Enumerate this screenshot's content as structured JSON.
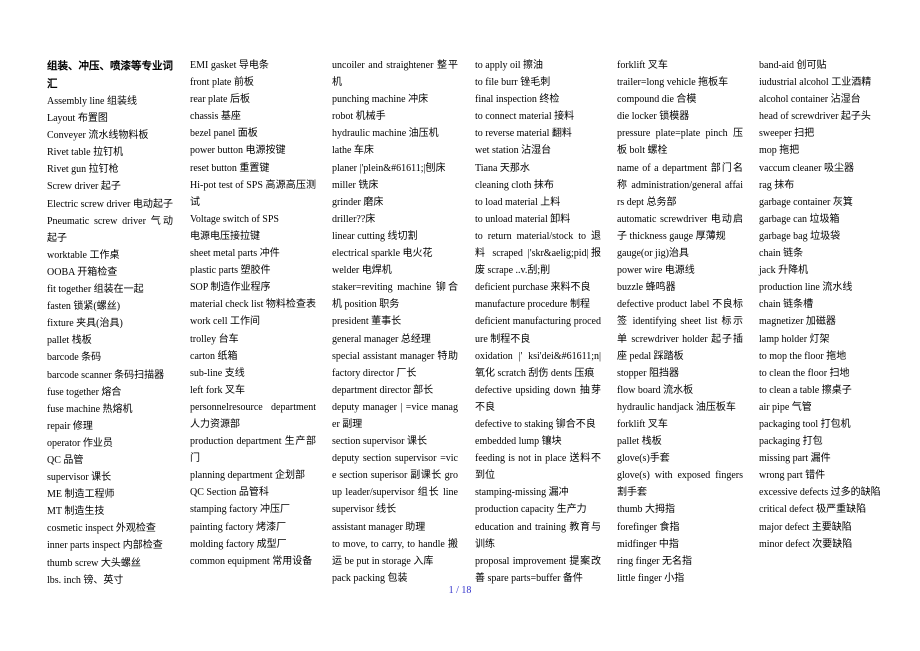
{
  "document": {
    "title": "组装、冲压、喷漆等专业词汇",
    "columns": [
      {
        "lines": [
          "Assembly line 组装线",
          "Layout 布置图",
          "Conveyer 流水线物料板",
          "Rivet table 拉钉机",
          "Rivet gun 拉钉枪",
          "Screw driver 起子",
          "Electric screw driver 电动起子 Pneumatic screw driver 气动起子",
          "worktable 工作桌",
          "OOBA 开箱检查",
          "fit together 组装在一起",
          "fasten 锁紧(螺丝)",
          "fixture 夹具(治具)",
          "pallet 栈板",
          "barcode 条码",
          "barcode scanner 条码扫描器",
          "fuse together 熔合",
          "fuse machine 热熔机",
          "repair 修理",
          "operator 作业员",
          "QC 品管",
          "supervisor 课长",
          "ME 制造工程师",
          "MT 制造生技",
          "cosmetic inspect 外观检查",
          "inner parts inspect 内部检查",
          "thumb screw 大头螺丝",
          "lbs. inch 镑、英寸"
        ]
      },
      {
        "lines": [
          "EMI gasket 导电条",
          "front plate 前板",
          "rear plate 后板",
          "chassis 基座",
          "bezel panel 面板",
          "power button 电源按键",
          "reset button 重置键",
          "Hi-pot test of SPS 高源高压测试",
          "Voltage switch of SPS",
          "电源电压接拉键",
          "sheet metal parts 冲件",
          "plastic parts 塑胶件",
          "SOP 制造作业程序",
          "material check list 物料检查表 work cell 工作间",
          "trolley 台车",
          "carton 纸箱",
          "sub-line 支线",
          "left fork 叉车",
          "personnelresource department 人力资源部",
          "production department 生产部门",
          "planning department 企划部",
          "QC Section 品管科",
          "stamping factory 冲压厂",
          "painting factory 烤漆厂",
          "molding factory 成型厂",
          "common equipment 常用设备"
        ]
      },
      {
        "lines": [
          "uncoiler and straightener 整平机",
          "punching machine 冲床",
          "robot 机械手",
          "hydraulic machine 油压机",
          "lathe 车床",
          "planer |'plein&#61611;|刨床",
          "miller 铣床",
          "grinder 磨床",
          "driller??床",
          "linear cutting 线切割",
          "electrical sparkle 电火花",
          "welder 电焊机",
          "staker=reviting machine 铆合机 position 职务",
          "president 董事长",
          "general manager 总经理",
          "special assistant manager 特助 factory director 厂长",
          "department director 部长",
          "deputy manager | =vice manager 副理",
          "section supervisor 课长",
          "deputy section supervisor =vice section superisor 副课长 group leader/supervisor 组长 line supervisor 线长",
          "assistant manager 助理",
          "to move, to carry, to handle 搬运 be put in storage 入库",
          "pack packing 包装"
        ]
      },
      {
        "lines": [
          "to apply oil 擦油",
          "to file burr 锉毛刺",
          "final inspection 终检",
          "to connect material 接料",
          "to reverse material 翻料",
          "wet station 沾湿台",
          "Tiana 天那水",
          "cleaning cloth 抹布",
          "to load material 上料",
          "to unload material 卸料",
          "to return material/stock to 退料 scraped |'skr&aelig;pid|报废 scrape ..v.刮;削",
          "deficient purchase 来料不良",
          "manufacture procedure 制程",
          "deficient manufacturing procedure 制程不良",
          "oxidation |' ksi'dei&#61611;n| 氧化 scratch 刮伤 dents 压痕",
          "defective upsiding down 抽芽不良",
          "defective to staking 铆合不良",
          "embedded lump 镶块",
          "feeding is not in place 送料不到位",
          "stamping-missing 漏冲",
          "production capacity 生产力",
          "education and training 教育与训练",
          "proposal improvement 提案改善 spare parts=buffer 备件"
        ]
      },
      {
        "lines": [
          "forklift 叉车",
          "trailer=long vehicle 拖板车",
          "compound die 合模",
          "die locker 锁模器",
          "pressure plate=plate pinch 压板 bolt 螺栓",
          "name of a department 部门名称 administration/general affairs dept 总务部",
          "automatic screwdriver 电动启子 thickness gauge 厚薄规",
          "gauge(or jig)治具",
          "power wire 电源线",
          "buzzle 蜂鸣器",
          "defective product label 不良标签 identifying sheet list 标示单 screwdriver holder 起子插座 pedal 踩踏板",
          "stopper 阻挡器",
          "flow board 流水板",
          "hydraulic handjack 油压板车",
          "forklift 叉车",
          "pallet 栈板",
          "glove(s)手套",
          "glove(s) with exposed fingers 割手套",
          "thumb 大拇指",
          "forefinger 食指",
          "midfinger 中指",
          "ring finger 无名指",
          "little finger 小指"
        ]
      },
      {
        "lines": [
          "band-aid 创可贴",
          "iudustrial alcohol 工业酒精",
          "alcohol container 沾湿台",
          "head of screwdriver 起子头",
          "sweeper 扫把",
          "mop 拖把",
          "vaccum cleaner 吸尘器",
          "rag 抹布",
          "garbage container 灰箕",
          "garbage can 垃圾箱",
          "garbage bag 垃圾袋",
          "chain 链条",
          "jack 升降机",
          "production line 流水线",
          "chain 链条槽",
          "magnetizer 加磁器",
          "lamp holder 灯架",
          "to mop the floor 拖地",
          "to clean the floor 扫地",
          "to clean a table 擦桌子",
          "air pipe 气管",
          "packaging tool 打包机",
          "packaging 打包",
          "missing part 漏件",
          "wrong part 错件",
          "excessive defects 过多的缺陷",
          "critical defect 极严重缺陷",
          "major defect 主要缺陷",
          "minor defect 次要缺陷"
        ]
      }
    ]
  },
  "footer": {
    "page_indicator": "1 / 18"
  },
  "colors": {
    "text": "#000000",
    "page_number": "#3333cc",
    "background": "#ffffff"
  }
}
